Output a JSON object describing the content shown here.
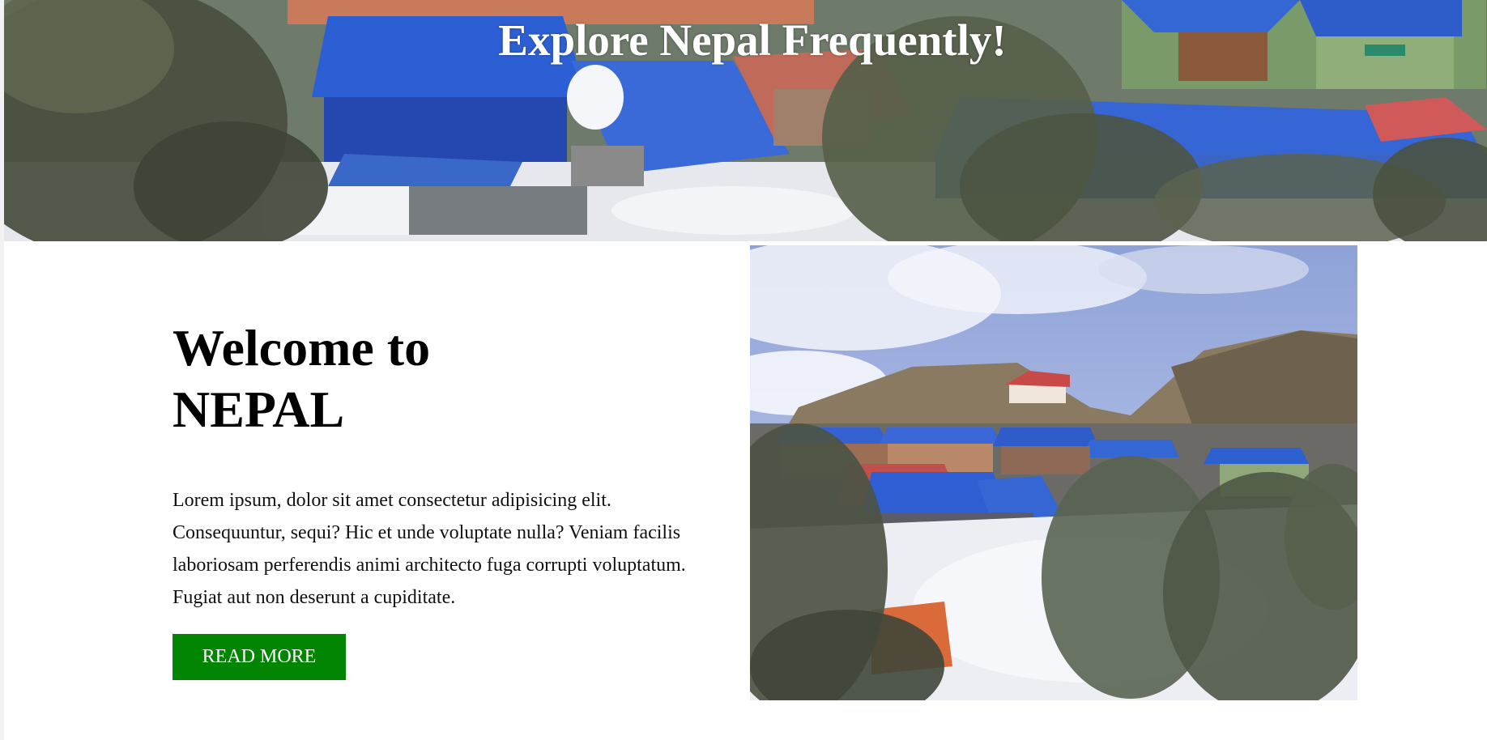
{
  "hero": {
    "title": "Explore Nepal Frequently!",
    "image_icon": "village-photo-banner"
  },
  "main": {
    "heading": "Welcome to NEPAL",
    "intro": "Lorem ipsum, dolor sit amet consectetur adipisicing elit. Consequuntur, sequi? Hic et unde voluptate nulla? Veniam facilis laboriosam perferendis animi architecto fuga corrupti voluptatum. Fugiat aut non deserunt a cupiditate.",
    "read_more_label": "READ MORE",
    "photo_icon": "mountain-village-photo"
  },
  "colors": {
    "button": "#028502",
    "roof_blue": "#2f5fd0",
    "sky": "#aab9e4"
  }
}
